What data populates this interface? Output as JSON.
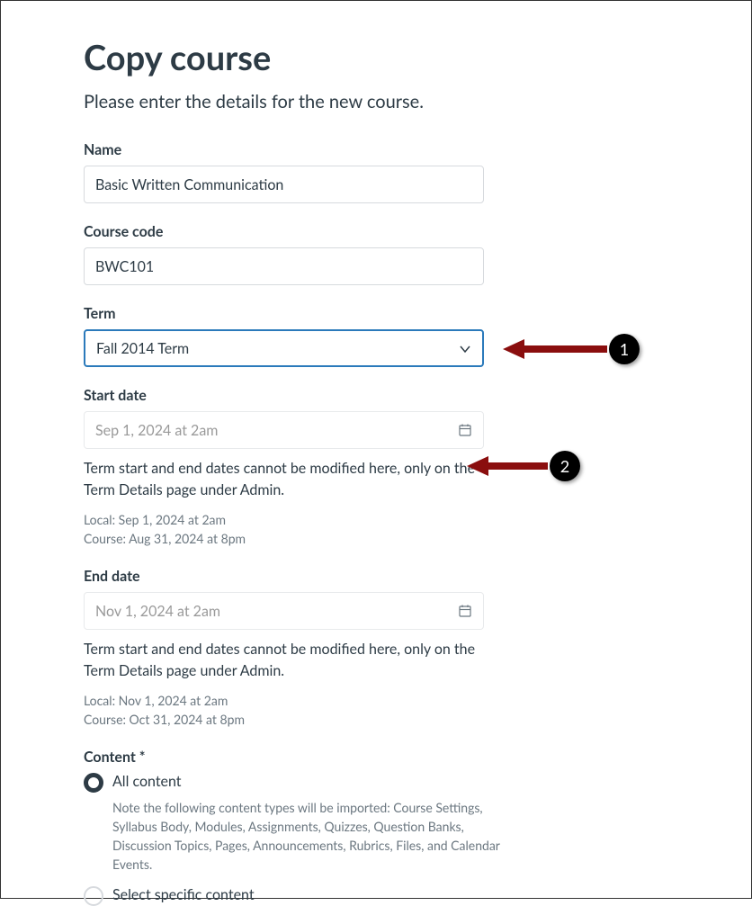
{
  "page": {
    "title": "Copy course",
    "subtitle": "Please enter the details for the new course."
  },
  "name": {
    "label": "Name",
    "value": "Basic Written Communication"
  },
  "courseCode": {
    "label": "Course code",
    "value": "BWC101"
  },
  "term": {
    "label": "Term",
    "value": "Fall 2014 Term"
  },
  "startDate": {
    "label": "Start date",
    "value": "Sep 1, 2024 at 2am",
    "helper": "Term start and end dates cannot be modified here, only on the Term Details page under Admin.",
    "local": "Local: Sep 1, 2024 at 2am",
    "course": "Course: Aug 31, 2024 at 8pm"
  },
  "endDate": {
    "label": "End date",
    "value": "Nov 1, 2024 at 2am",
    "helper": "Term start and end dates cannot be modified here, only on the Term Details page under Admin.",
    "local": "Local: Nov 1, 2024 at 2am",
    "course": "Course: Oct 31, 2024 at 8pm"
  },
  "content": {
    "label": "Content *",
    "options": {
      "all": {
        "label": "All content",
        "desc": "Note the following content types will be imported: Course Settings, Syllabus Body, Modules, Assignments, Quizzes, Question Banks, Discussion Topics, Pages, Announcements, Rubrics, Files, and Calendar Events."
      },
      "specific": {
        "label": "Select specific content"
      }
    }
  },
  "annotations": {
    "one": "1",
    "two": "2"
  }
}
